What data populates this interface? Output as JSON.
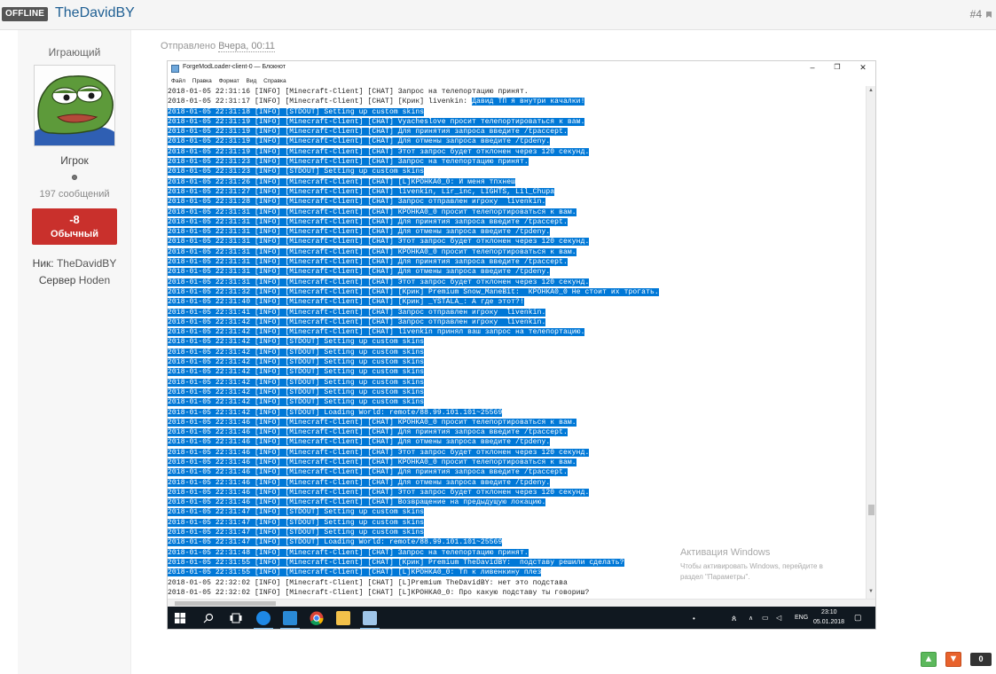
{
  "post_header": {
    "status_badge": "OFFLINE",
    "author_name": "TheDavidBY",
    "post_number": "#4"
  },
  "author_panel": {
    "group_title": "Играющий",
    "avatar_icon": "pepe-frog-avatar",
    "rank_title": "Игрок",
    "post_count": "197 сообщений",
    "reputation_value": "-8",
    "reputation_label": "Обычный",
    "reputation_color": "#c9302c",
    "fields": [
      {
        "key": "Ник:",
        "value": "TheDavidBY"
      },
      {
        "key": "Сервер",
        "value": "Hoden"
      }
    ]
  },
  "post": {
    "posted_label": "Отправлено",
    "posted_time": "Вчера, 00:11"
  },
  "notepad": {
    "title": "ForgeModLoader-client-0 — Блокнот",
    "menu": [
      "Файл",
      "Правка",
      "Формат",
      "Вид",
      "Справка"
    ],
    "selection_color": "#0078d7",
    "lines": [
      {
        "pre": "2018-01-05 22:31:16 [INFO] [Minecraft-Client] [CHAT] Запрос на телепортацию принят.",
        "sel": ""
      },
      {
        "pre": "2018-01-05 22:31:17 [INFO] [Minecraft-Client] [CHAT] [Крик] livenkin: ",
        "sel": "Давид ТП я внутри качалки!"
      },
      {
        "pre": "",
        "sel": "2018-01-05 22:31:18 [INFO] [STDOUT] Setting up custom skins"
      },
      {
        "pre": "",
        "sel": "2018-01-05 22:31:19 [INFO] [Minecraft-Client] [CHAT] Vyacheslove просит телепортироваться к вам."
      },
      {
        "pre": "",
        "sel": "2018-01-05 22:31:19 [INFO] [Minecraft-Client] [CHAT] Для принятия запроса введите /tpaccept."
      },
      {
        "pre": "",
        "sel": "2018-01-05 22:31:19 [INFO] [Minecraft-Client] [CHAT] Для отмены запроса введите /tpdeny."
      },
      {
        "pre": "",
        "sel": "2018-01-05 22:31:19 [INFO] [Minecraft-Client] [CHAT] Этот запрос будет отклонен через 120 секунд."
      },
      {
        "pre": "",
        "sel": "2018-01-05 22:31:23 [INFO] [Minecraft-Client] [CHAT] Запрос на телепортацию принят."
      },
      {
        "pre": "",
        "sel": "2018-01-05 22:31:23 [INFO] [STDOUT] Setting up custom skins"
      },
      {
        "pre": "",
        "sel": "2018-01-05 22:31:26 [INFO] [Minecraft-Client] [CHAT] [L]КРОНКА0_0: И меня тпхнеш"
      },
      {
        "pre": "",
        "sel": "2018-01-05 22:31:27 [INFO] [Minecraft-Client] [CHAT] livenkin, Lir_inc, LIGHTS, Lil_Chupa"
      },
      {
        "pre": "",
        "sel": "2018-01-05 22:31:28 [INFO] [Minecraft-Client] [CHAT] Запрос отправлен игроку  livenkin."
      },
      {
        "pre": "",
        "sel": "2018-01-05 22:31:31 [INFO] [Minecraft-Client] [CHAT] КРОНКА0_0 просит телепортироваться к вам."
      },
      {
        "pre": "",
        "sel": "2018-01-05 22:31:31 [INFO] [Minecraft-Client] [CHAT] Для принятия запроса введите /tpaccept."
      },
      {
        "pre": "",
        "sel": "2018-01-05 22:31:31 [INFO] [Minecraft-Client] [CHAT] Для отмены запроса введите /tpdeny."
      },
      {
        "pre": "",
        "sel": "2018-01-05 22:31:31 [INFO] [Minecraft-Client] [CHAT] Этот запрос будет отклонен через 120 секунд."
      },
      {
        "pre": "",
        "sel": "2018-01-05 22:31:31 [INFO] [Minecraft-Client] [CHAT] КРОНКА0_0 просит телепортироваться к вам."
      },
      {
        "pre": "",
        "sel": "2018-01-05 22:31:31 [INFO] [Minecraft-Client] [CHAT] Для принятия запроса введите /tpaccept."
      },
      {
        "pre": "",
        "sel": "2018-01-05 22:31:31 [INFO] [Minecraft-Client] [CHAT] Для отмены запроса введите /tpdeny."
      },
      {
        "pre": "",
        "sel": "2018-01-05 22:31:31 [INFO] [Minecraft-Client] [CHAT] Этот запрос будет отклонен через 120 секунд."
      },
      {
        "pre": "",
        "sel": "2018-01-05 22:31:32 [INFO] [Minecraft-Client] [CHAT] [Крик] Premium Snow_ManeBit:  КРОНКА0_0 Не стоит их трогать."
      },
      {
        "pre": "",
        "sel": "2018-01-05 22:31:40 [INFO] [Minecraft-Client] [CHAT] [Крик] _YSTALA_: А где этот?!"
      },
      {
        "pre": "",
        "sel": "2018-01-05 22:31:41 [INFO] [Minecraft-Client] [CHAT] Запрос отправлен игроку  livenkin."
      },
      {
        "pre": "",
        "sel": "2018-01-05 22:31:42 [INFO] [Minecraft-Client] [CHAT] Запрос отправлен игроку  livenkin."
      },
      {
        "pre": "",
        "sel": "2018-01-05 22:31:42 [INFO] [Minecraft-Client] [CHAT] livenkin принял ваш запрос на телепортацию."
      },
      {
        "pre": "",
        "sel": "2018-01-05 22:31:42 [INFO] [STDOUT] Setting up custom skins"
      },
      {
        "pre": "",
        "sel": "2018-01-05 22:31:42 [INFO] [STDOUT] Setting up custom skins"
      },
      {
        "pre": "",
        "sel": "2018-01-05 22:31:42 [INFO] [STDOUT] Setting up custom skins"
      },
      {
        "pre": "",
        "sel": "2018-01-05 22:31:42 [INFO] [STDOUT] Setting up custom skins"
      },
      {
        "pre": "",
        "sel": "2018-01-05 22:31:42 [INFO] [STDOUT] Setting up custom skins"
      },
      {
        "pre": "",
        "sel": "2018-01-05 22:31:42 [INFO] [STDOUT] Setting up custom skins"
      },
      {
        "pre": "",
        "sel": "2018-01-05 22:31:42 [INFO] [STDOUT] Setting up custom skins"
      },
      {
        "pre": "",
        "sel": "2018-01-05 22:31:42 [INFO] [STDOUT] Loading World: remote/88.99.101.101~25569"
      },
      {
        "pre": "",
        "sel": "2018-01-05 22:31:46 [INFO] [Minecraft-Client] [CHAT] КРОНКА0_0 просит телепортироваться к вам."
      },
      {
        "pre": "",
        "sel": "2018-01-05 22:31:46 [INFO] [Minecraft-Client] [CHAT] Для принятия запроса введите /tpaccept."
      },
      {
        "pre": "",
        "sel": "2018-01-05 22:31:46 [INFO] [Minecraft-Client] [CHAT] Для отмены запроса введите /tpdeny."
      },
      {
        "pre": "",
        "sel": "2018-01-05 22:31:46 [INFO] [Minecraft-Client] [CHAT] Этот запрос будет отклонен через 120 секунд."
      },
      {
        "pre": "",
        "sel": "2018-01-05 22:31:46 [INFO] [Minecraft-Client] [CHAT] КРОНКА0_0 просит телепортироваться к вам."
      },
      {
        "pre": "",
        "sel": "2018-01-05 22:31:46 [INFO] [Minecraft-Client] [CHAT] Для принятия запроса введите /tpaccept."
      },
      {
        "pre": "",
        "sel": "2018-01-05 22:31:46 [INFO] [Minecraft-Client] [CHAT] Для отмены запроса введите /tpdeny."
      },
      {
        "pre": "",
        "sel": "2018-01-05 22:31:46 [INFO] [Minecraft-Client] [CHAT] Этот запрос будет отклонен через 120 секунд."
      },
      {
        "pre": "",
        "sel": "2018-01-05 22:31:46 [INFO] [Minecraft-Client] [CHAT] Возвращение на предыдущую локацию."
      },
      {
        "pre": "",
        "sel": "2018-01-05 22:31:47 [INFO] [STDOUT] Setting up custom skins"
      },
      {
        "pre": "",
        "sel": "2018-01-05 22:31:47 [INFO] [STDOUT] Setting up custom skins"
      },
      {
        "pre": "",
        "sel": "2018-01-05 22:31:47 [INFO] [STDOUT] Setting up custom skins"
      },
      {
        "pre": "",
        "sel": "2018-01-05 22:31:47 [INFO] [STDOUT] Loading World: remote/88.99.101.101~25569"
      },
      {
        "pre": "",
        "sel": "2018-01-05 22:31:48 [INFO] [Minecraft-Client] [CHAT] Запрос на телепортацию принят."
      },
      {
        "pre": "",
        "sel": "2018-01-05 22:31:55 [INFO] [Minecraft-Client] [CHAT] [Крик] Premium TheDavidBY:  подставу решили сделать?"
      },
      {
        "pre": "",
        "sel": "2018-01-05 22:31:55 [INFO] [Minecraft-Client] [CHAT] [L]КРОНКА0_0: Тп к ливенкину плез"
      },
      {
        "pre": "2018-01-05 22:32:02 [INFO] [Minecraft-Client] [CHAT] [L]Premium TheDavidBY: нет это подстава",
        "sel": ""
      },
      {
        "pre": "2018-01-05 22:32:02 [INFO] [Minecraft-Client] [CHAT] [L]КРОНКА0_0: Про какую подставу ты говориш?",
        "sel": ""
      }
    ]
  },
  "watermark": {
    "title": "Активация Windows",
    "line1": "Чтобы активировать Windows, перейдите в",
    "line2": "раздел \"Параметры\"."
  },
  "taskbar": {
    "language": "ENG",
    "time": "23:10",
    "date": "05.01.2018"
  },
  "votes": {
    "count": "0",
    "up_color": "#5cb85c",
    "down_color": "#e8622c"
  }
}
